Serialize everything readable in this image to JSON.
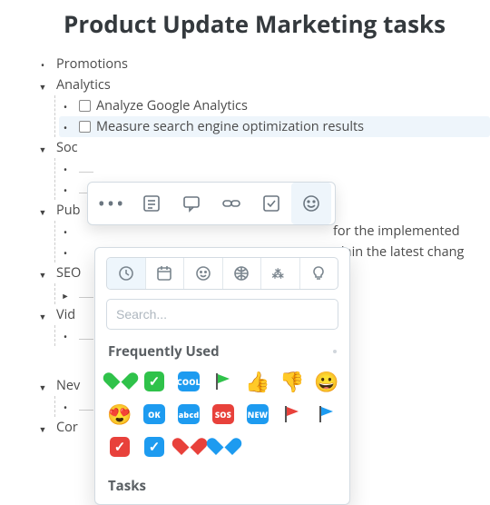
{
  "title": "Product Update Marketing tasks",
  "tree": {
    "promotions": "Promotions",
    "analytics": "Analytics",
    "analytics_items": [
      "Analyze Google Analytics",
      "Measure search engine optimization results"
    ],
    "social": "Soc",
    "publishing": "Pub",
    "pub_line1": "for the implemented",
    "pub_line2": "plain the latest chang",
    "seo": "SEO",
    "video": "Vid",
    "newsletter": "Nev",
    "community": "Cor"
  },
  "toolbar": {
    "more": "•••"
  },
  "picker": {
    "search_placeholder": "Search...",
    "section_frequent": "Frequently Used",
    "section_tasks": "Tasks",
    "tabs": [
      "recent",
      "calendar",
      "smileys",
      "activity",
      "symbols",
      "objects"
    ],
    "frequent": [
      {
        "kind": "heart",
        "color": "#2fc24a",
        "name": "green-heart"
      },
      {
        "kind": "check",
        "color": "#2fc24a",
        "name": "green-check"
      },
      {
        "kind": "text",
        "color": "#1d9bf0",
        "text": "COOL",
        "name": "cool-badge"
      },
      {
        "kind": "flag",
        "color": "#2fc24a",
        "name": "green-flag"
      },
      {
        "kind": "unicode",
        "char": "👍",
        "name": "thumbs-up"
      },
      {
        "kind": "unicode",
        "char": "👎",
        "name": "thumbs-down"
      },
      {
        "kind": "unicode",
        "char": "😀",
        "name": "grinning"
      },
      {
        "kind": "unicode",
        "char": "😍",
        "name": "heart-eyes"
      },
      {
        "kind": "text",
        "color": "#1d9bf0",
        "text": "OK",
        "name": "ok-badge"
      },
      {
        "kind": "text",
        "color": "#1d9bf0",
        "text": "abcd",
        "name": "abcd-badge"
      },
      {
        "kind": "text",
        "color": "#e8413b",
        "text": "SOS",
        "name": "sos-badge"
      },
      {
        "kind": "text",
        "color": "#1d9bf0",
        "text": "NEW",
        "name": "new-badge"
      },
      {
        "kind": "flag",
        "color": "#e8413b",
        "name": "red-flag"
      },
      {
        "kind": "flag",
        "color": "#1d9bf0",
        "name": "blue-flag"
      },
      {
        "kind": "check",
        "color": "#e8413b",
        "name": "red-check"
      },
      {
        "kind": "check",
        "color": "#1d9bf0",
        "name": "blue-check"
      },
      {
        "kind": "heart",
        "color": "#e8413b",
        "name": "red-heart"
      },
      {
        "kind": "heart",
        "color": "#1d9bf0",
        "name": "blue-heart"
      }
    ]
  }
}
